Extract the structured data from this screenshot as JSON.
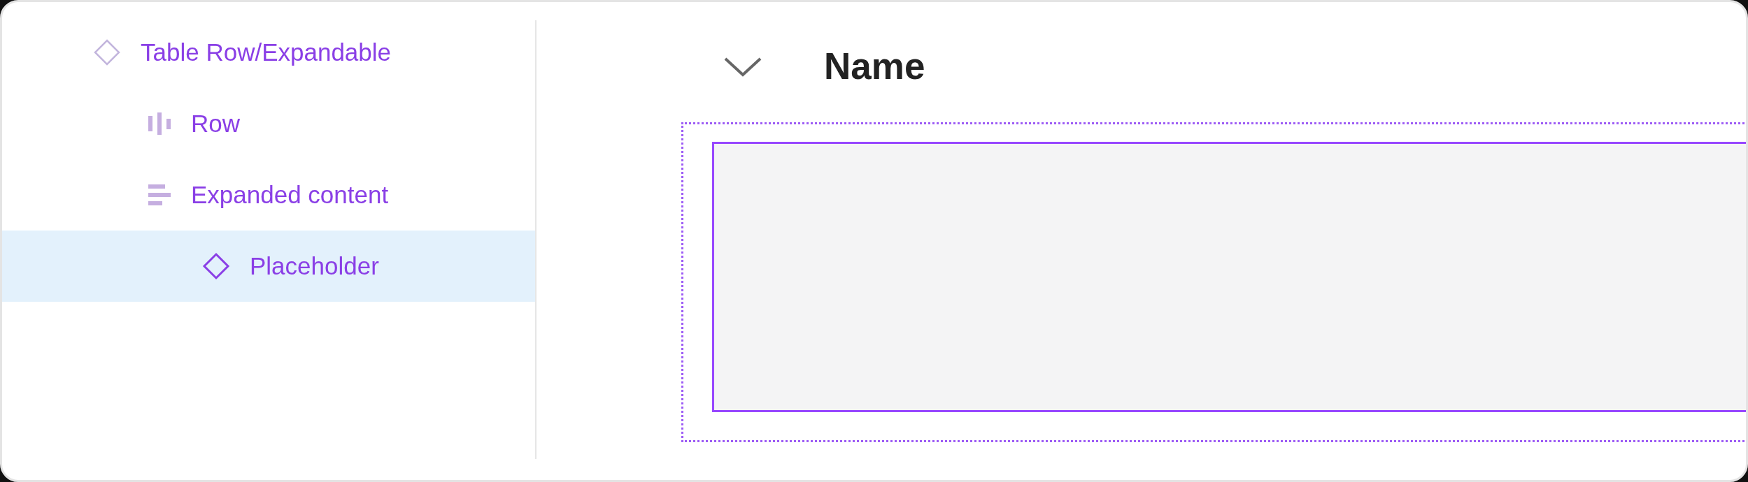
{
  "layers": [
    {
      "label": "Table Row/Expandable",
      "kind": "component-set",
      "selected": false,
      "children": [
        {
          "label": "Row",
          "kind": "row-layout",
          "selected": false
        },
        {
          "label": "Expanded content",
          "kind": "column-layout",
          "selected": false,
          "children": [
            {
              "label": "Placeholder",
              "kind": "instance",
              "selected": true
            }
          ]
        }
      ]
    }
  ],
  "canvas": {
    "expanded": true,
    "heading": "Name"
  }
}
